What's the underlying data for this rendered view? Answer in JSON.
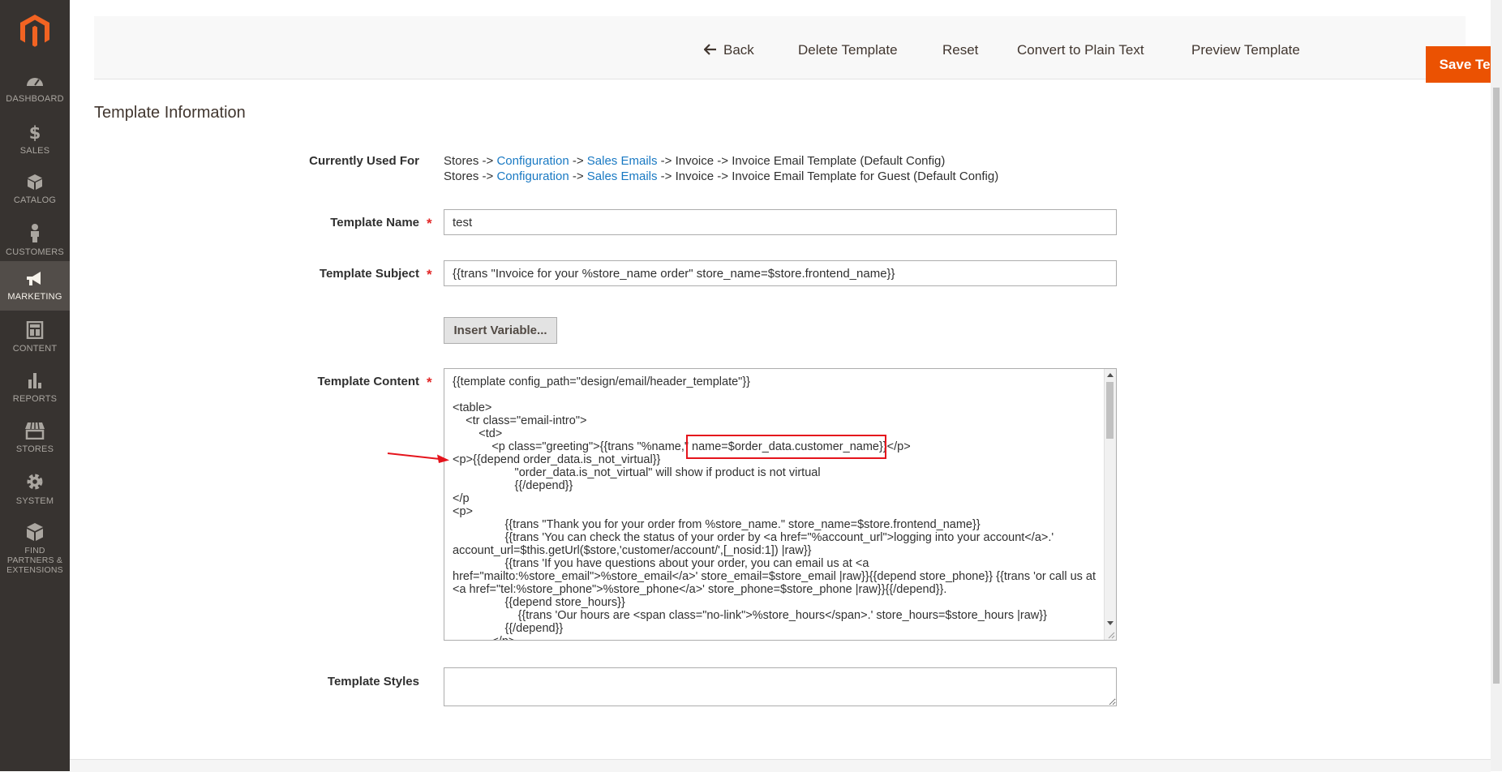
{
  "sidebar": {
    "items": [
      {
        "label": "DASHBOARD",
        "icon": "dashboard-icon"
      },
      {
        "label": "SALES",
        "icon": "dollar-icon"
      },
      {
        "label": "CATALOG",
        "icon": "cube-icon"
      },
      {
        "label": "CUSTOMERS",
        "icon": "person-icon"
      },
      {
        "label": "MARKETING",
        "icon": "megaphone-icon",
        "active": true
      },
      {
        "label": "CONTENT",
        "icon": "layout-icon"
      },
      {
        "label": "REPORTS",
        "icon": "bar-chart-icon"
      },
      {
        "label": "STORES",
        "icon": "store-icon"
      },
      {
        "label": "SYSTEM",
        "icon": "gear-icon"
      },
      {
        "label": "FIND PARTNERS & EXTENSIONS",
        "icon": "box-icon"
      }
    ]
  },
  "actions": {
    "back": "Back",
    "delete": "Delete Template",
    "reset": "Reset",
    "convert": "Convert to Plain Text",
    "preview": "Preview Template",
    "save": "Save Template"
  },
  "form": {
    "section_title": "Template Information",
    "currently_used_for": {
      "label": "Currently Used For",
      "lines": [
        {
          "p1": "Stores -> ",
          "link1": "Configuration",
          "p2": " -> ",
          "link2": "Sales Emails",
          "p3": " -> Invoice -> Invoice Email Template  (Default Config)"
        },
        {
          "p1": "Stores -> ",
          "link1": "Configuration",
          "p2": " -> ",
          "link2": "Sales Emails",
          "p3": " -> Invoice -> Invoice Email Template for Guest  (Default Config)"
        }
      ]
    },
    "template_name": {
      "label": "Template Name",
      "value": "test"
    },
    "template_subject": {
      "label": "Template Subject",
      "value": "{{trans \"Invoice for your %store_name order\" store_name=$store.frontend_name}}"
    },
    "insert_variable": "Insert Variable...",
    "template_content": {
      "label": "Template Content",
      "value": "{{template config_path=\"design/email/header_template\"}}\n\n<table>\n    <tr class=\"email-intro\">\n        <td>\n            <p class=\"greeting\">{{trans \"%name,\" name=$order_data.customer_name}}</p>\n<p>{{depend order_data.is_not_virtual}}\n                   \"order_data.is_not_virtual\" will show if product is not virtual\n                   {{/depend}}\n</p\n<p>\n                {{trans \"Thank you for your order from %store_name.\" store_name=$store.frontend_name}}\n                {{trans 'You can check the status of your order by <a href=\"%account_url\">logging into your account</a>.' account_url=$this.getUrl($store,'customer/account/',[_nosid:1]) |raw}}\n                {{trans 'If you have questions about your order, you can email us at <a href=\"mailto:%store_email\">%store_email</a>' store_email=$store_email |raw}}{{depend store_phone}} {{trans 'or call us at <a href=\"tel:%store_phone\">%store_phone</a>' store_phone=$store_phone |raw}}{{/depend}}.\n                {{depend store_hours}}\n                    {{trans 'Our hours are <span class=\"no-link\">%store_hours</span>.' store_hours=$store_hours |raw}}\n                {{/depend}}\n            </p>"
    },
    "template_styles": {
      "label": "Template Styles",
      "value": ""
    }
  },
  "colors": {
    "sidebar_bg": "#373330",
    "sidebar_active": "#524d49",
    "accent": "#eb5202",
    "link": "#1979c3",
    "annotation": "#e5141c"
  }
}
